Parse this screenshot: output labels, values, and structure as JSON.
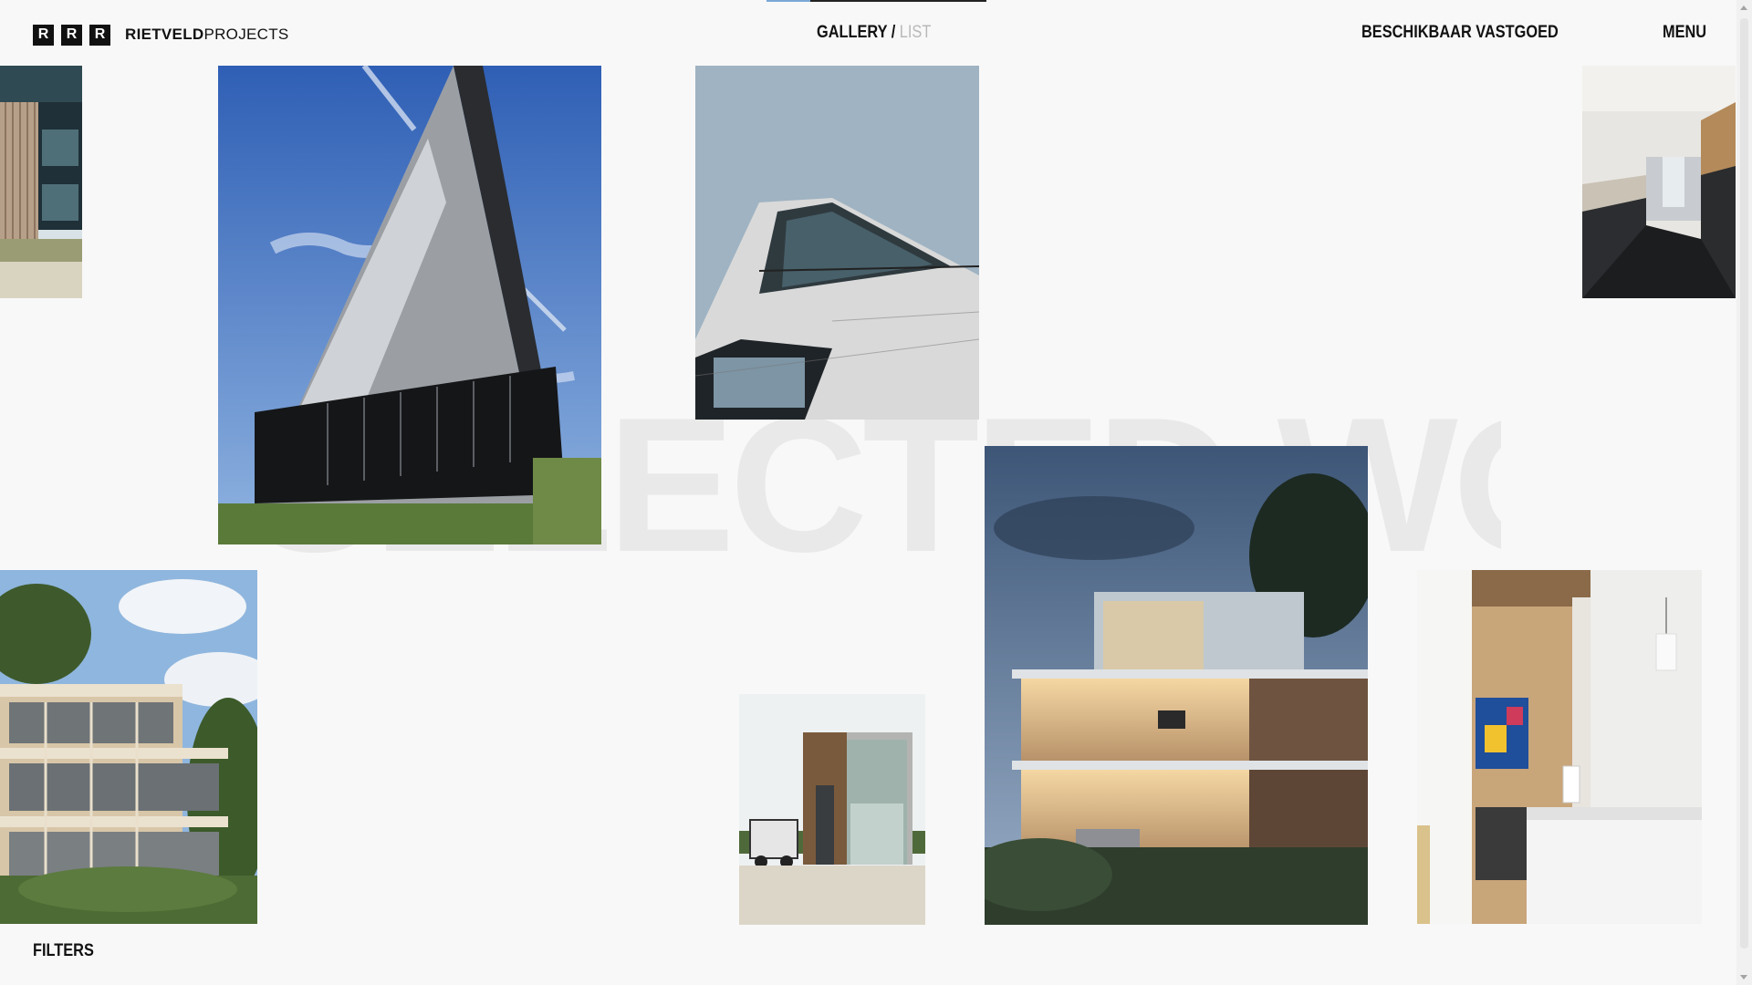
{
  "header": {
    "logo_letters": [
      "R",
      "R",
      "R"
    ],
    "brand_bold": "RIETVELD",
    "brand_light": "PROJECTS",
    "view_gallery": "GALLERY",
    "view_separator": " / ",
    "view_list": "LIST",
    "nav_available": "BESCHIKBAAR VASTGOED",
    "nav_menu": "MENU"
  },
  "background_word": "SELECTED WORK",
  "footer": {
    "filters": "FILTERS"
  },
  "colors": {
    "background": "#f8f8f8",
    "text": "#111111",
    "muted": "#b8b8b8",
    "accent": "#7aa7d6"
  }
}
